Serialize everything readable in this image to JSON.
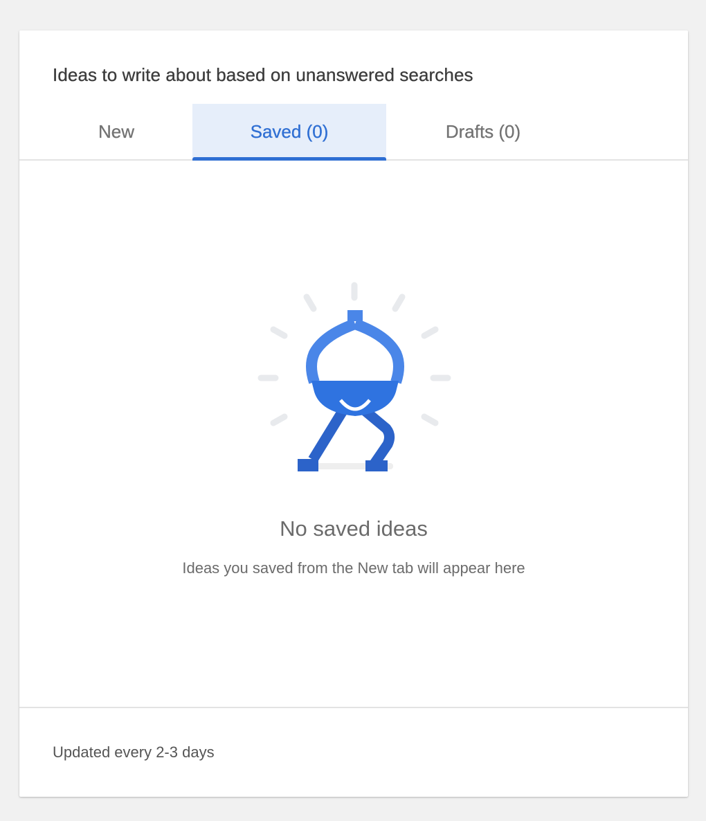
{
  "card": {
    "title": "Ideas to write about based on unanswered searches"
  },
  "tabs": [
    {
      "label": "New",
      "selected": false
    },
    {
      "label": "Saved (0)",
      "selected": true
    },
    {
      "label": "Drafts (0)",
      "selected": false
    }
  ],
  "empty_state": {
    "illustration_icon": "lightbulb-character-icon",
    "title": "No saved ideas",
    "subtitle": "Ideas you saved from the New tab will appear here"
  },
  "footer": {
    "text": "Updated every 2-3 days"
  },
  "colors": {
    "accent": "#2f6fd3",
    "selected_tab_bg": "#e6eefa",
    "page_bg": "#f1f1f1"
  }
}
